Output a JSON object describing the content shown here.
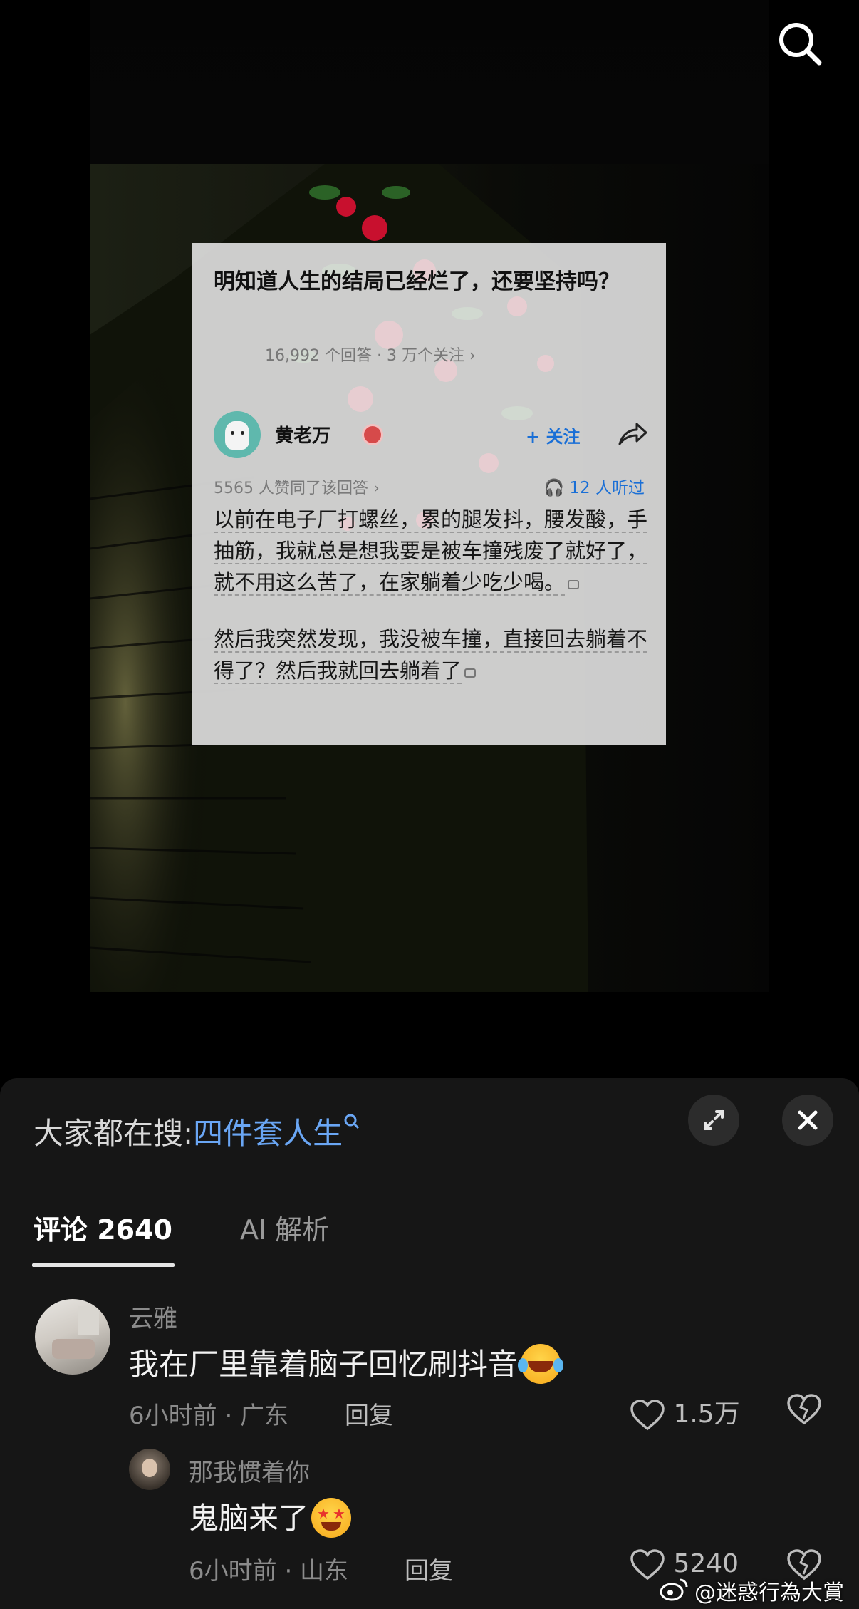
{
  "card": {
    "question": "明知道人生的结局已经烂了，还要坚持吗？",
    "question_meta": "16,992 个回答 · 3 万个关注 ›",
    "author_name": "黄老万",
    "follow_label": "+ 关注",
    "agree_text": "5565 人赞同了该回答 ›",
    "listen_text": "12 人听过",
    "paragraph1": "以前在电子厂打螺丝，累的腿发抖，腰发酸，手抽筋，我就总是想我要是被车撞残废了就好了，就不用这么苦了，在家躺着少吃少喝。",
    "paragraph2": "然后我突然发现，我没被车撞，直接回去躺着不得了？然后我就回去躺着了"
  },
  "sheet": {
    "search_prefix": "大家都在搜:",
    "search_term": "四件套人生",
    "tab_comments": "评论 2640",
    "tab_ai": "AI 解析"
  },
  "comments": [
    {
      "user": "云雅",
      "text": "我在厂里靠着脑子回忆刷抖音",
      "emoji": "laughing-crying",
      "meta": "6小时前 · 广东",
      "reply_label": "回复",
      "likes": "1.5万"
    },
    {
      "user": "那我惯着你",
      "text": "鬼脑来了",
      "emoji": "star-struck",
      "meta": "6小时前 · 山东",
      "reply_label": "回复",
      "likes": "5240"
    }
  ],
  "watermark": "@迷惑行為大賞",
  "colors": {
    "link_blue": "#6aa6f4",
    "card_blue": "#1a6fd6",
    "sheet_bg": "#161616"
  }
}
